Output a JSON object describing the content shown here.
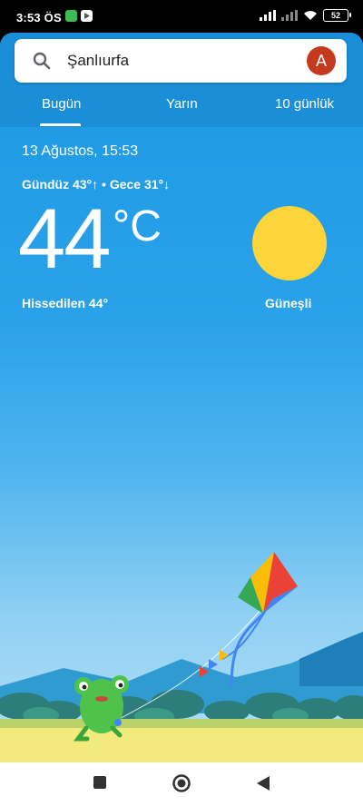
{
  "status_bar": {
    "time": "3:53 ÖS",
    "battery": "52",
    "app_icons": [
      "whatsapp-icon",
      "play-store-icon"
    ],
    "app_icon_colors": [
      "#3dbb55",
      "#ffffff"
    ]
  },
  "search": {
    "query": "Şanlıurfa",
    "avatar_letter": "A"
  },
  "tabs": [
    {
      "label": "Bugün",
      "selected": true
    },
    {
      "label": "Yarın",
      "selected": false
    },
    {
      "label": "10 günlük",
      "selected": false
    }
  ],
  "weather": {
    "date_time": "13 Ağustos, 15:53",
    "day_night": "Gündüz 43°↑ • Gece 31°↓",
    "temperature": "44",
    "unit": "°C",
    "feels_like": "Hissedilen 44°",
    "condition": "Güneşli",
    "condition_icon": "sun-icon"
  },
  "colors": {
    "header": "#1a8fd8",
    "sky_top": "#1b98e2",
    "sun": "#fdd43a",
    "avatar": "#c5391f",
    "grass": "#f2ea7c",
    "frog": "#4ec24b"
  },
  "navigation": [
    "recents-square-icon",
    "home-circle-icon",
    "back-triangle-icon"
  ]
}
